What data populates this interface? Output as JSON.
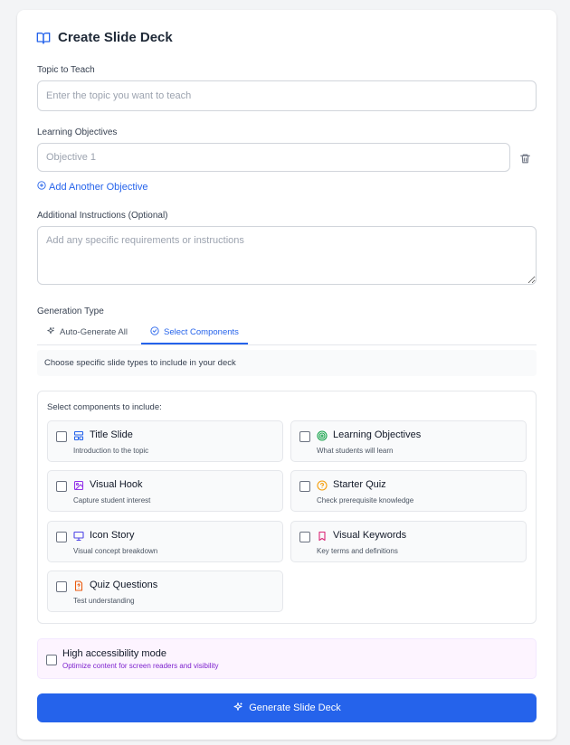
{
  "header": {
    "title": "Create Slide Deck",
    "icon": "book-open-icon"
  },
  "topic": {
    "label": "Topic to Teach",
    "placeholder": "Enter the topic you want to teach",
    "value": ""
  },
  "objectives": {
    "label": "Learning Objectives",
    "items": [
      {
        "placeholder": "Objective 1",
        "value": ""
      }
    ],
    "add_label": "Add Another Objective"
  },
  "instructions": {
    "label": "Additional Instructions (Optional)",
    "placeholder": "Add any specific requirements or instructions",
    "value": ""
  },
  "generation": {
    "label": "Generation Type",
    "tabs": [
      {
        "label": "Auto-Generate All",
        "icon": "sparkles-icon",
        "active": false
      },
      {
        "label": "Select Components",
        "icon": "check-circle-icon",
        "active": true
      }
    ],
    "description": "Choose specific slide types to include in your deck"
  },
  "components": {
    "heading": "Select components to include:",
    "items": [
      {
        "name": "Title Slide",
        "desc": "Introduction to the topic",
        "icon": "layout-icon",
        "color": "#2563eb",
        "checked": false
      },
      {
        "name": "Learning Objectives",
        "desc": "What students will learn",
        "icon": "target-icon",
        "color": "#16a34a",
        "checked": false
      },
      {
        "name": "Visual Hook",
        "desc": "Capture student interest",
        "icon": "image-icon",
        "color": "#9333ea",
        "checked": false
      },
      {
        "name": "Starter Quiz",
        "desc": "Check prerequisite knowledge",
        "icon": "help-circle-icon",
        "color": "#f59e0b",
        "checked": false
      },
      {
        "name": "Icon Story",
        "desc": "Visual concept breakdown",
        "icon": "presentation-icon",
        "color": "#4f46e5",
        "checked": false
      },
      {
        "name": "Visual Keywords",
        "desc": "Key terms and definitions",
        "icon": "bookmark-icon",
        "color": "#db2777",
        "checked": false
      },
      {
        "name": "Quiz Questions",
        "desc": "Test understanding",
        "icon": "file-question-icon",
        "color": "#ea580c",
        "checked": false
      }
    ]
  },
  "accessibility": {
    "label": "High accessibility mode",
    "desc": "Optimize content for screen readers and visibility",
    "checked": false
  },
  "submit": {
    "label": "Generate Slide Deck",
    "icon": "sparkles-icon"
  },
  "colors": {
    "primary": "#2563eb",
    "accessibility_bg": "#fdf4ff",
    "accessibility_text": "#7e22ce"
  }
}
